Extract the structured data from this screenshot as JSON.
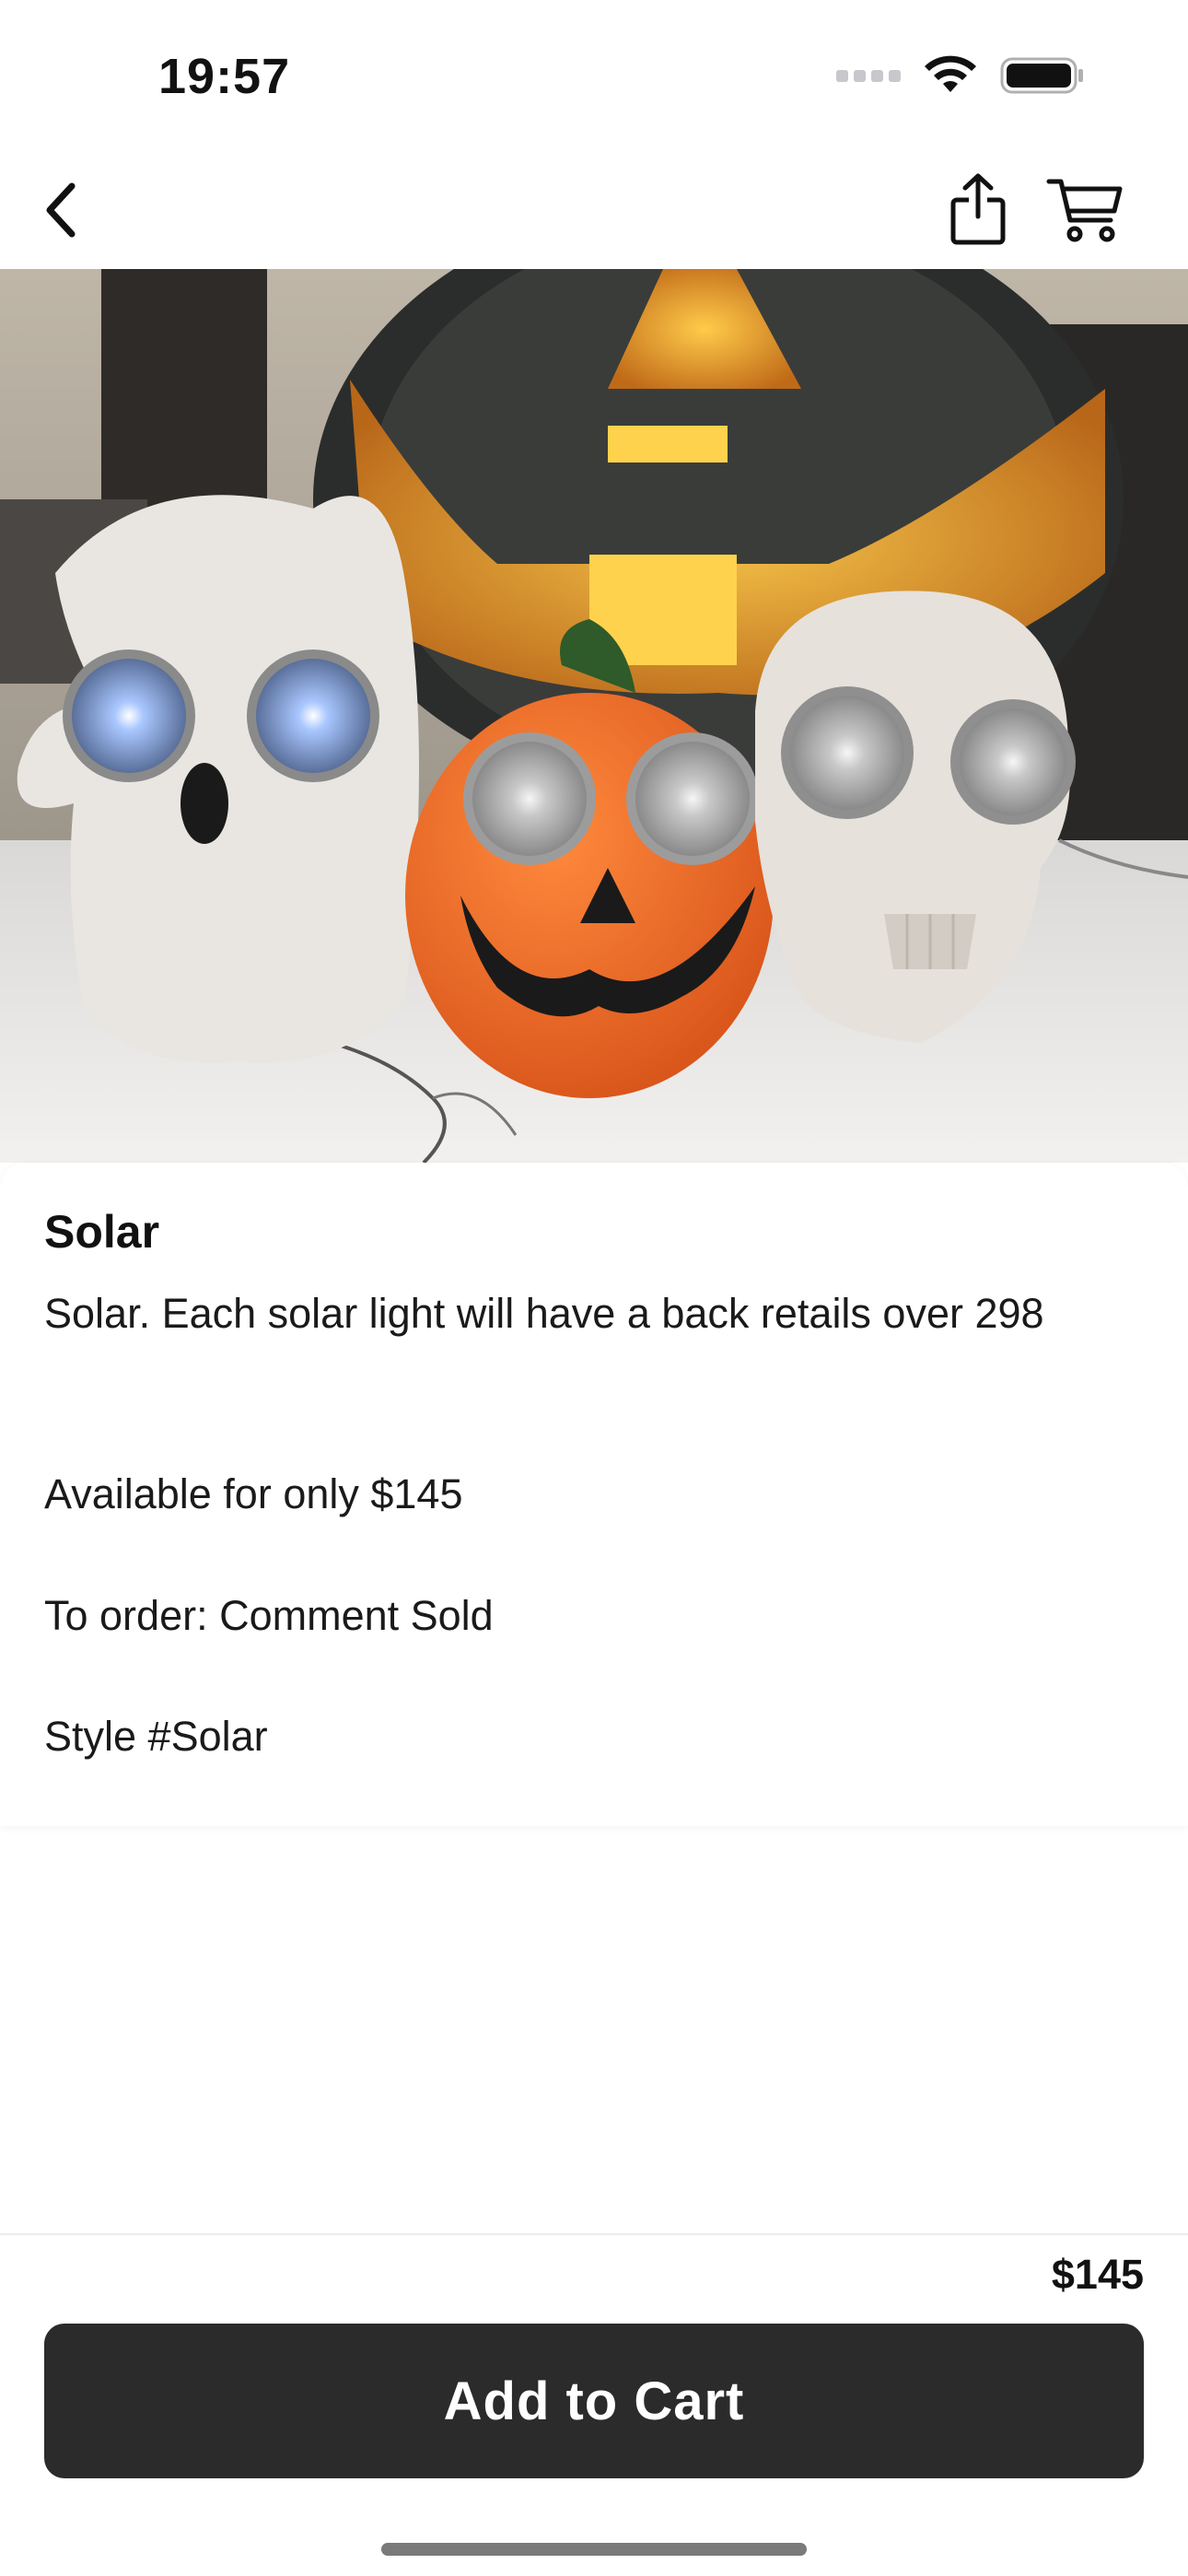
{
  "status_bar": {
    "time": "19:57",
    "icons": [
      "signal-dots-icon",
      "wifi-icon",
      "battery-icon"
    ]
  },
  "nav": {
    "back_icon": "chevron-left-icon",
    "share_icon": "share-icon",
    "cart_icon": "cart-icon"
  },
  "product": {
    "image_icon": "product-photo",
    "title": "Solar",
    "description_lines": [
      "Solar. Each solar light will have a back retails over 298",
      "Available for only $145",
      "To order: Comment Sold",
      "Style #Solar"
    ]
  },
  "footer": {
    "price": "$145",
    "add_to_cart_label": "Add to Cart"
  },
  "colors": {
    "button_bg": "#2b2b2b",
    "button_text": "#ffffff",
    "pumpkin_orange": "#ef6a22"
  }
}
